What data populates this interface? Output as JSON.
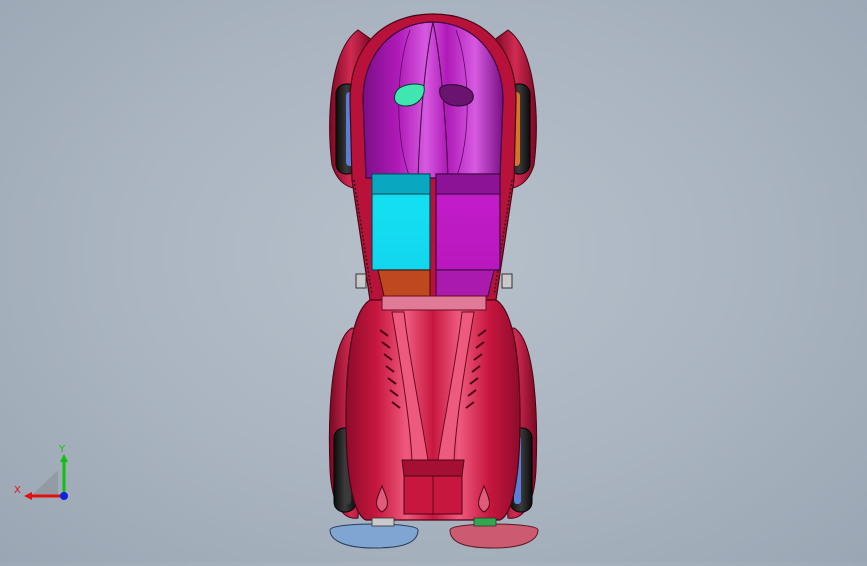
{
  "viewport": {
    "background_colors": [
      "#b7c1cc",
      "#9aa6b3"
    ]
  },
  "model": {
    "palette": {
      "body_red": "#c8173f",
      "body_red_dark": "#8e0b2b",
      "body_red_light": "#ee5a7e",
      "cabin_magenta": "#b01ab8",
      "cabin_magenta_light": "#d65ae0",
      "seat_cyan": "#14e0f2",
      "seat_cyan_dark": "#0aa7c0",
      "seat_magenta": "#c21cc8",
      "seat_magenta_dark": "#8c1296",
      "seat_rust": "#c0481e",
      "tire": "#1a1a1a",
      "rim_blue": "#5a7fd6",
      "rim_orange": "#d6742a",
      "window_green": "#3fe6b2",
      "window_purple": "#6a1470",
      "footrest_blue": "#7fa6d2",
      "footrest_pink": "#cc5a70",
      "bumper_pink": "#e07a96"
    }
  },
  "triad": {
    "x_label": "X",
    "y_label": "Y",
    "x_color": "#e01010",
    "y_color": "#10c010",
    "z_color": "#1020e0"
  }
}
